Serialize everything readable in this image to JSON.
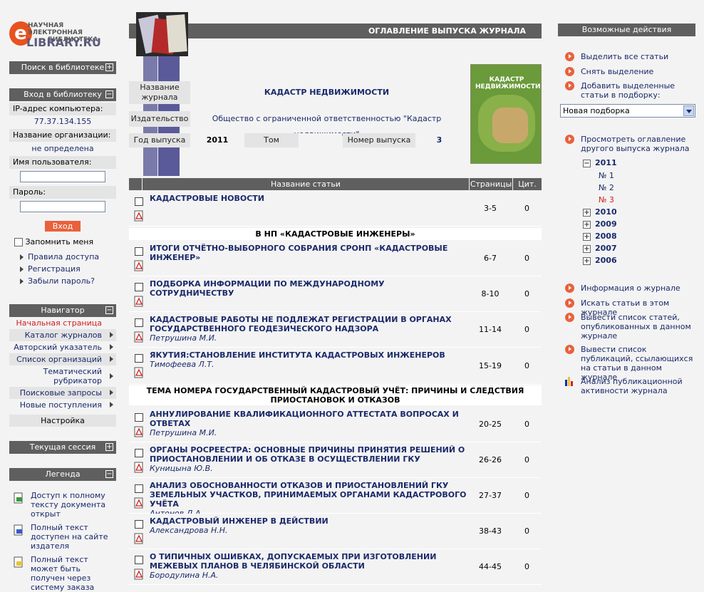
{
  "logo": {
    "line1": "НАУЧНАЯ ЭЛЕКТРОННАЯ",
    "line2": "БИБЛИОТЕКА",
    "brand": "LIBRARY.RU",
    "letter": "e"
  },
  "left": {
    "search_bar": "Поиск в библиотеке",
    "login_bar": "Вход в библиотеку",
    "ip_label": "IP-адрес компьютера:",
    "ip_value": "77.37.134.155",
    "org_label": "Название организации:",
    "org_value": "не определена",
    "user_label": "Имя пользователя:",
    "pass_label": "Пароль:",
    "login_button": "Вход",
    "remember": "Запомнить меня",
    "links": [
      "Правила доступа",
      "Регистрация",
      "Забыли пароль?"
    ],
    "nav_bar": "Навигатор",
    "nav_items": [
      "Начальная страница",
      "Каталог журналов",
      "Авторский указатель",
      "Список организаций",
      "Тематический рубрикатор",
      "Поисковые запросы",
      "Новые поступления",
      "Настройка"
    ],
    "session_bar": "Текущая сессия",
    "legend_bar": "Легенда",
    "legend_items": [
      "Доступ к полному тексту документа открыт",
      "Полный текст доступен на сайте издателя",
      "Полный текст может быть получен через систему заказа"
    ]
  },
  "center": {
    "header": "ОГЛАВЛЕНИЕ ВЫПУСКА ЖУРНАЛА",
    "journal_label": "Название журнала",
    "journal_value": "КАДАСТР НЕДВИЖИМОСТИ",
    "publisher_label": "Издательство",
    "publisher_value": "Общество с ограниченной ответственностью \"Кадастр недвижимости\"",
    "year_label": "Год выпуска",
    "year_value": "2011",
    "volume_label": "Том",
    "volume_value": "",
    "issue_label": "Номер выпуска",
    "issue_value": "3",
    "cover_text": "КАДАСТР НЕДВИЖИМОСТИ",
    "table_headers": {
      "title": "Название статьи",
      "pages": "Страницы",
      "cit": "Цит."
    },
    "sections": [
      "В НП «КАДАСТРОВЫЕ ИНЖЕНЕРЫ»",
      "ТЕМА НОМЕРА ГОСУДАРСТВЕННЫЙ КАДАСТРОВЫЙ УЧЁТ: ПРИЧИНЫ И СЛЕДСТВИЯ ПРИОСТАНОВОК И ОТКАЗОВ"
    ],
    "articles": [
      {
        "title": "КАДАСТРОВЫЕ НОВОСТИ",
        "author": "",
        "pages": "3-5",
        "cit": "0"
      },
      {
        "title": "ИТОГИ ОТЧЁТНО-ВЫБОРНОГО СОБРАНИЯ СРОНП «КАДАСТРОВЫЕ ИНЖЕНЕР»",
        "author": "",
        "pages": "6-7",
        "cit": "0"
      },
      {
        "title": "ПОДБОРКА ИНФОРМАЦИИ ПО МЕЖДУНАРОДНОМУ СОТРУДНИЧЕСТВУ",
        "author": "",
        "pages": "8-10",
        "cit": "0"
      },
      {
        "title": "КАДАСТРОВЫЕ РАБОТЫ НЕ ПОДЛЕЖАТ РЕГИСТРАЦИИ В ОРГАНАХ ГОСУДАРСТВЕННОГО ГЕОДЕЗИЧЕСКОГО НАДЗОРА",
        "author": "Петрушина М.И.",
        "pages": "11-14",
        "cit": "0"
      },
      {
        "title": "ЯКУТИЯ:СТАНОВЛЕНИЕ ИНСТИТУТА КАДАСТРОВЫХ ИНЖЕНЕРОВ",
        "author": "Тимофеева Л.Т.",
        "pages": "15-19",
        "cit": "0"
      },
      {
        "title": "АННУЛИРОВАНИЕ КВАЛИФИКАЦИОННОГО АТТЕСТАТА ВОПРОСАХ И ОТВЕТАХ",
        "author": "Петрушина М.И.",
        "pages": "20-25",
        "cit": "0"
      },
      {
        "title": "ОРГАНЫ РОСРЕЕСТРА: ОСНОВНЫЕ ПРИЧИНЫ ПРИНЯТИЯ РЕШЕНИЙ О ПРИОСТАНОВЛЕНИИ И ОБ ОТКАЗЕ В ОСУЩЕСТВЛЕНИИ ГКУ",
        "author": "Куницына Ю.В.",
        "pages": "26-26",
        "cit": "0"
      },
      {
        "title": "АНАЛИЗ ОБОСНОВАННОСТИ ОТКАЗОВ И ПРИОСТАНОВЛЕНИЙ ГКУ ЗЕМЕЛЬНЫХ УЧАСТКОВ, ПРИНИМАЕМЫХ ОРГАНАМИ КАДАСТРОВОГО УЧЁТА",
        "author": "Антонов Д.А.",
        "pages": "27-37",
        "cit": "0"
      },
      {
        "title": "КАДАСТРОВЫЙ ИНЖЕНЕР В ДЕЙСТВИИ",
        "author": "Александрова Н.Н.",
        "pages": "38-43",
        "cit": "0"
      },
      {
        "title": "О ТИПИЧНЫХ ОШИБКАХ, ДОПУСКАЕМЫХ ПРИ ИЗГОТОВЛЕНИИ МЕЖЕВЫХ ПЛАНОВ В ЧЕЛЯБИНСКОЙ ОБЛАСТИ",
        "author": "Бородулина Н.А.",
        "pages": "44-45",
        "cit": "0"
      }
    ]
  },
  "right": {
    "bar": "Возможные действия",
    "actions": [
      "Выделить все статьи",
      "Снять выделение",
      "Добавить выделенные статьи в подборку:"
    ],
    "select_value": "Новая подборка",
    "browse": "Просмотреть оглавление другого выпуска журнала",
    "years": [
      {
        "y": "2011",
        "sign": "−"
      },
      {
        "y": "2010",
        "sign": "+"
      },
      {
        "y": "2009",
        "sign": "+"
      },
      {
        "y": "2008",
        "sign": "+"
      },
      {
        "y": "2007",
        "sign": "+"
      },
      {
        "y": "2006",
        "sign": "+"
      }
    ],
    "issues": [
      "№ 1",
      "№ 2",
      "№ 3"
    ],
    "more": [
      "Информация о журнале",
      "Искать статьи в этом журнале",
      "Вывести список статей, опубликованных в данном журнале",
      "Вывести список публикаций, ссылающихся на статьи в данном журнале",
      "Анализ публикационной активности журнала"
    ],
    "accent": "#e8613d",
    "current_issue_color": "#d02020"
  }
}
